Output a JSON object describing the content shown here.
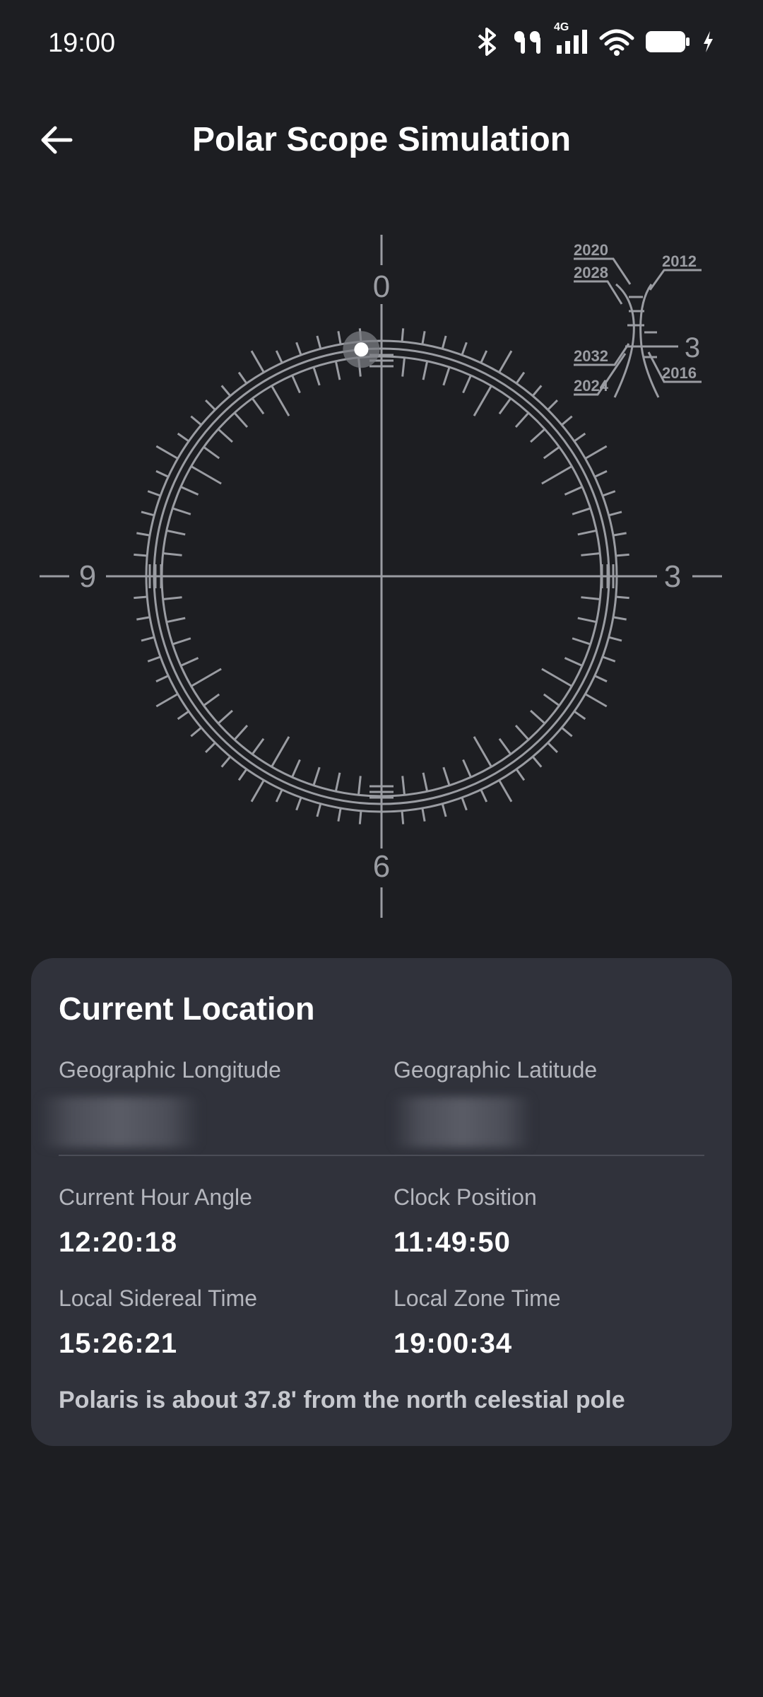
{
  "status_bar": {
    "time": "19:00",
    "network": "4G",
    "icons": [
      "bluetooth-icon",
      "earbuds-icon",
      "signal-icon",
      "wifi-icon",
      "battery-icon",
      "charging-icon"
    ]
  },
  "header": {
    "title": "Polar Scope Simulation",
    "back_icon": "arrow-left-icon"
  },
  "reticle": {
    "labels": {
      "top": "0",
      "right": "3",
      "bottom": "6",
      "left": "9"
    },
    "epoch_labels": {
      "y2020": "2020",
      "y2028": "2028",
      "y2012": "2012",
      "y2032": "2032",
      "y2024": "2024",
      "y2016": "2016",
      "mark": "3"
    },
    "polaris_hour_position": 11.83
  },
  "location": {
    "title": "Current Location",
    "longitude_label": "Geographic Longitude",
    "latitude_label": "Geographic Latitude",
    "hour_angle_label": "Current Hour Angle",
    "hour_angle": "12:20:18",
    "clock_position_label": "Clock Position",
    "clock_position": "11:49:50",
    "sidereal_label": "Local Sidereal Time",
    "sidereal_time": "15:26:21",
    "zone_time_label": "Local Zone Time",
    "zone_time": "19:00:34",
    "note": "Polaris is about 37.8' from the north celestial pole"
  },
  "colors": {
    "background": "#1d1e22",
    "card": "#30323b",
    "reticle": "#9a9ca2",
    "text": "#ffffff",
    "label": "#b4b6bd"
  }
}
